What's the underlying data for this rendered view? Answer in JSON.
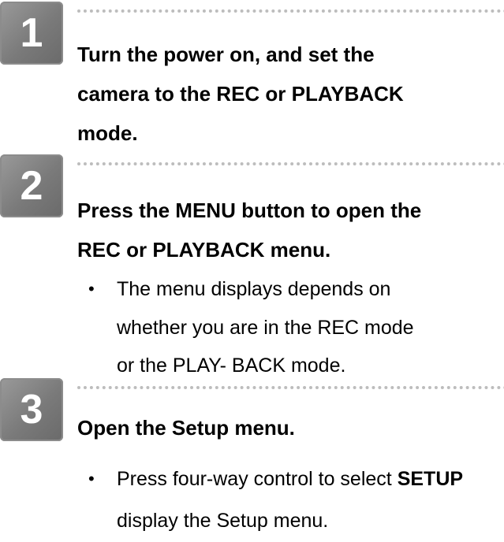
{
  "steps": [
    {
      "number": "1",
      "heading_lines": [
        "Turn the power on, and set the",
        "camera to the REC or PLAYBACK",
        "mode."
      ]
    },
    {
      "number": "2",
      "heading_lines": [
        "Press the MENU button to open the",
        "REC or PLAYBACK menu."
      ],
      "bullet": {
        "symbol": "•",
        "lines": [
          "The menu displays depends on",
          "whether you are in the REC mode",
          "or the PLAY- BACK mode."
        ]
      }
    },
    {
      "number": "3",
      "heading_lines": [
        "Open the Setup menu."
      ],
      "bullet": {
        "symbol": "•",
        "line1_prefix": "Press four-way control to select ",
        "line1_bold": "SETUP",
        "line2": "display the Setup menu."
      }
    }
  ]
}
